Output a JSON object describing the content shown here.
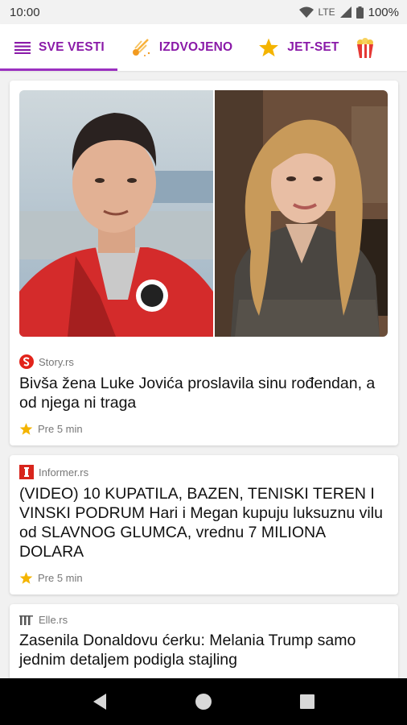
{
  "status": {
    "time": "10:00",
    "network": "LTE",
    "battery": "100%"
  },
  "tabs": [
    {
      "label": "SVE VESTI",
      "icon": "menu-icon",
      "active": true
    },
    {
      "label": "IZDVOJENO",
      "icon": "comet-icon",
      "active": false
    },
    {
      "label": "JET-SET",
      "icon": "star-icon",
      "active": false
    },
    {
      "label": "",
      "icon": "popcorn-icon",
      "active": false
    }
  ],
  "articles": [
    {
      "source": "Story.rs",
      "headline": "Bivša žena Luke Jovića proslavila sinu rođendan, a od njega ni traga",
      "time": "Pre 5 min",
      "has_image": true
    },
    {
      "source": "Informer.rs",
      "headline": "(VIDEO) 10 KUPATILA, BAZEN, TENISKI TEREN I VINSKI PODRUM Hari i Megan kupuju luksuznu vilu od SLAVNOG GLUMCA, vrednu 7 MILIONA DOLARA",
      "time": "Pre 5 min",
      "has_image": false
    },
    {
      "source": "Elle.rs",
      "headline": "Zasenila Donaldovu ćerku: Melania Trump samo jednim detaljem podigla stajling",
      "time": "",
      "has_image": false
    }
  ],
  "colors": {
    "accent": "#8a1aa8",
    "star": "#f4b400",
    "story_logo": "#e2231a",
    "informer_logo": "#d8251c"
  }
}
